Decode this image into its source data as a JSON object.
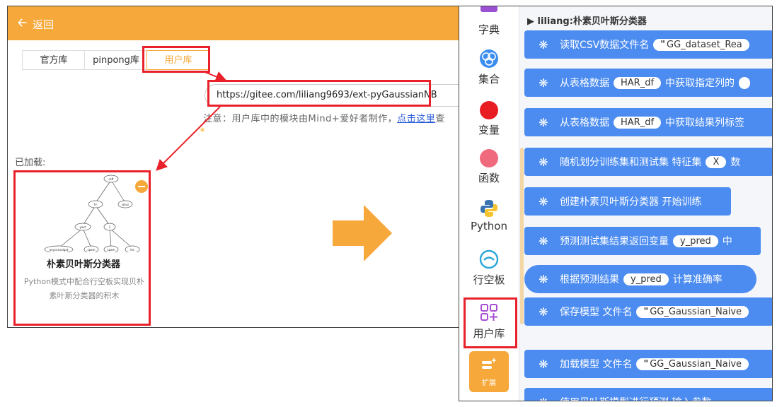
{
  "left": {
    "back_label": "返回",
    "tabs": [
      "官方库",
      "pinpong库",
      "用户库"
    ],
    "url": "https://gitee.com/liliang9693/ext-pyGaussianNB",
    "note_prefix": "注意：用户库中的模块由Mind+爱好者制作，",
    "note_link": "点击这里",
    "note_suffix": "查",
    "loaded_label": "已加载:",
    "card_title": "朴素贝叶斯分类器",
    "card_desc": "Python模式中配合行空板实现贝朴素叶斯分类器的积木",
    "tree_nodes": [
      "raft",
      "hr",
      "sjnus",
      "yaxt",
      "1",
      "anyconsaigat",
      "spam",
      "spam",
      "kis"
    ]
  },
  "sidebar": {
    "items": [
      {
        "label": "字典",
        "icon": "dictionary-icon"
      },
      {
        "label": "集合",
        "icon": "set-icon"
      },
      {
        "label": "变量",
        "icon": "variable-icon"
      },
      {
        "label": "函数",
        "icon": "function-icon"
      },
      {
        "label": "Python",
        "icon": "python-icon"
      },
      {
        "label": "行空板",
        "icon": "unihiker-icon"
      },
      {
        "label": "用户库",
        "icon": "user-library-icon"
      },
      {
        "label": "扩展",
        "icon": "extension-icon"
      }
    ]
  },
  "blocks": {
    "category": "liliang:朴素贝叶斯分类器",
    "b1": {
      "text": "读取CSV数据文件名",
      "value": "GG_dataset_Rea"
    },
    "b2": {
      "text": "从表格数据",
      "pill": "HAR_df",
      "text2": "中获取指定列的"
    },
    "b3": {
      "text": "从表格数据",
      "pill": "HAR_df",
      "text2": "中获取结果列标签"
    },
    "b4": {
      "text": "随机划分训练集和测试集 特征集",
      "pill": "X",
      "text2": "数"
    },
    "b5": {
      "text": "创建朴素贝叶斯分类器 开始训练"
    },
    "b6": {
      "text": "预测测试集结果返回变量",
      "pill": "y_pred",
      "text2": "中"
    },
    "b7": {
      "text": "根据预测结果",
      "pill": "y_pred",
      "text2": "计算准确率"
    },
    "b8": {
      "text": "保存模型 文件名",
      "value": "GG_Gaussian_Naive"
    },
    "b9": {
      "text": "加载模型 文件名",
      "value": "GG_Gaussian_Naive"
    },
    "b10": {
      "text": "使用贝叶斯模型进行预测 输入参数"
    }
  },
  "colors": {
    "accent": "#f7a83a",
    "block": "#4c8cf0",
    "highlight": "#e8212a"
  }
}
